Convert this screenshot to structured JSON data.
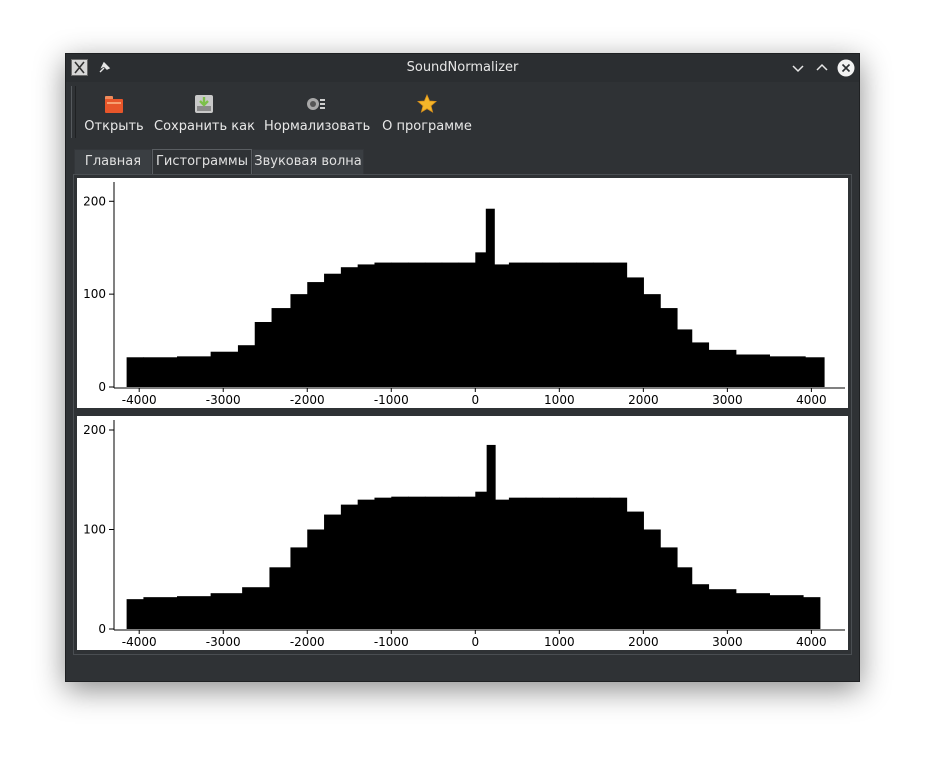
{
  "window": {
    "title": "SoundNormalizer"
  },
  "toolbar": {
    "open_label": "Открыть",
    "save_label": "Сохранить как",
    "normalize_label": "Нормализовать",
    "about_label": "О программе"
  },
  "tabs": [
    {
      "label": "Главная",
      "active": false
    },
    {
      "label": "Гистограммы",
      "active": true
    },
    {
      "label": "Звуковая волна",
      "active": false
    }
  ],
  "colors": {
    "window_bg": "#2f3235",
    "plot_bg": "#ffffff",
    "bars": "#000000",
    "open_icon": "#e8562a",
    "save_icon": "#7cc04a",
    "about_icon": "#f5b62a"
  },
  "icons": {
    "app": "app-icon",
    "pin": "pin-icon",
    "open": "folder-open-icon",
    "save": "save-as-icon",
    "normalize": "speaker-icon",
    "about": "star-icon",
    "minimize": "chevron-down-icon",
    "maximize": "chevron-up-icon",
    "close": "close-icon"
  },
  "chart_data": [
    {
      "type": "bar",
      "title": "",
      "xlabel": "",
      "ylabel": "",
      "xlim": [
        -4300,
        4400
      ],
      "ylim": [
        0,
        210
      ],
      "xticks": [
        -4000,
        -3000,
        -2000,
        -1000,
        0,
        1000,
        2000,
        3000,
        4000
      ],
      "xtick_labels": [
        "-4000",
        "-3000",
        "-2000",
        "-1000",
        "0",
        "1000",
        "2000",
        "3000",
        "4000"
      ],
      "yticks": [
        0,
        100,
        200
      ],
      "ytick_labels": [
        "0",
        "100",
        "200"
      ],
      "grid": false,
      "x": [
        -4150,
        -3750,
        -3350,
        -2950,
        -2700,
        -2550,
        -2300,
        -2100,
        -1900,
        -1700,
        -1500,
        -1300,
        -1100,
        -900,
        -700,
        -500,
        -300,
        -100,
        100,
        150,
        300,
        500,
        700,
        900,
        1100,
        1300,
        1500,
        1700,
        1900,
        2100,
        2300,
        2500,
        2650,
        2900,
        3300,
        3700,
        4150
      ],
      "values": [
        32,
        32,
        33,
        38,
        45,
        70,
        85,
        100,
        113,
        122,
        129,
        132,
        134,
        134,
        134,
        134,
        134,
        134,
        145,
        192,
        132,
        134,
        134,
        134,
        134,
        134,
        134,
        134,
        118,
        100,
        85,
        62,
        48,
        40,
        35,
        33,
        32
      ]
    },
    {
      "type": "bar",
      "title": "",
      "xlabel": "",
      "ylabel": "",
      "xlim": [
        -4300,
        4400
      ],
      "ylim": [
        0,
        200
      ],
      "xticks": [
        -4000,
        -3000,
        -2000,
        -1000,
        0,
        1000,
        2000,
        3000,
        4000
      ],
      "xtick_labels": [
        "-4000",
        "-3000",
        "-2000",
        "-1000",
        "0",
        "1000",
        "2000",
        "3000",
        "4000"
      ],
      "yticks": [
        0,
        100,
        200
      ],
      "ytick_labels": [
        "0",
        "100",
        "200"
      ],
      "grid": false,
      "x": [
        -4150,
        -3750,
        -3350,
        -2950,
        -2600,
        -2300,
        -2100,
        -1900,
        -1700,
        -1500,
        -1300,
        -1100,
        -900,
        -700,
        -500,
        -300,
        -100,
        100,
        170,
        300,
        500,
        700,
        900,
        1100,
        1300,
        1500,
        1700,
        1900,
        2100,
        2300,
        2500,
        2650,
        2900,
        3300,
        3700,
        4100
      ],
      "values": [
        30,
        32,
        33,
        36,
        42,
        62,
        82,
        100,
        115,
        125,
        130,
        132,
        133,
        133,
        133,
        133,
        133,
        138,
        185,
        130,
        132,
        132,
        132,
        132,
        132,
        132,
        132,
        118,
        100,
        82,
        62,
        45,
        40,
        36,
        34,
        32
      ]
    }
  ]
}
